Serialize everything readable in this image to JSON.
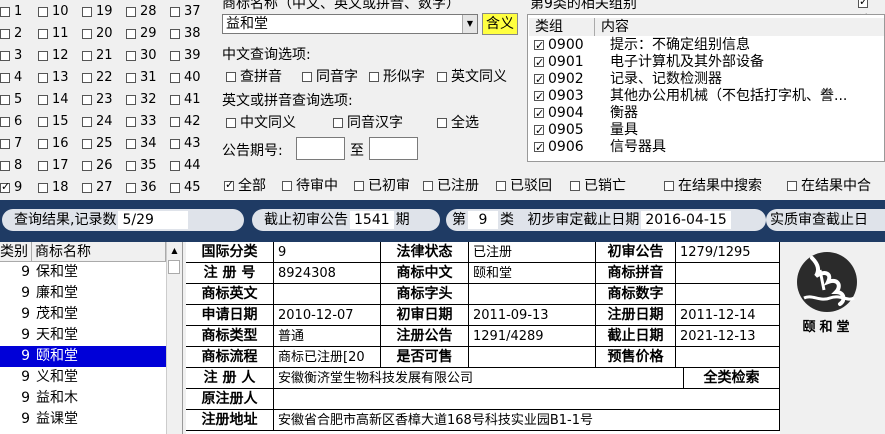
{
  "class_grid": {
    "columns": [
      [
        {
          "n": "1",
          "on": false
        },
        {
          "n": "2",
          "on": false
        },
        {
          "n": "3",
          "on": false
        },
        {
          "n": "4",
          "on": false
        },
        {
          "n": "5",
          "on": false
        },
        {
          "n": "6",
          "on": false
        },
        {
          "n": "7",
          "on": false
        },
        {
          "n": "8",
          "on": false
        },
        {
          "n": "9",
          "on": true
        }
      ],
      [
        {
          "n": "10",
          "on": false
        },
        {
          "n": "11",
          "on": false
        },
        {
          "n": "12",
          "on": false
        },
        {
          "n": "13",
          "on": false
        },
        {
          "n": "14",
          "on": false
        },
        {
          "n": "15",
          "on": false
        },
        {
          "n": "16",
          "on": false
        },
        {
          "n": "17",
          "on": false
        },
        {
          "n": "18",
          "on": false
        }
      ],
      [
        {
          "n": "19",
          "on": false
        },
        {
          "n": "20",
          "on": false
        },
        {
          "n": "21",
          "on": false
        },
        {
          "n": "22",
          "on": false
        },
        {
          "n": "23",
          "on": false
        },
        {
          "n": "24",
          "on": false
        },
        {
          "n": "25",
          "on": false
        },
        {
          "n": "26",
          "on": false
        },
        {
          "n": "27",
          "on": false
        }
      ],
      [
        {
          "n": "28",
          "on": false
        },
        {
          "n": "29",
          "on": false
        },
        {
          "n": "30",
          "on": false
        },
        {
          "n": "31",
          "on": false
        },
        {
          "n": "32",
          "on": false
        },
        {
          "n": "33",
          "on": false
        },
        {
          "n": "34",
          "on": false
        },
        {
          "n": "35",
          "on": false
        },
        {
          "n": "36",
          "on": false
        }
      ],
      [
        {
          "n": "37",
          "on": false
        },
        {
          "n": "38",
          "on": false
        },
        {
          "n": "39",
          "on": false
        },
        {
          "n": "40",
          "on": false
        },
        {
          "n": "41",
          "on": false
        },
        {
          "n": "42",
          "on": false
        },
        {
          "n": "43",
          "on": false
        },
        {
          "n": "44",
          "on": false
        },
        {
          "n": "45",
          "on": false
        }
      ]
    ]
  },
  "search": {
    "label": "商标名称（中文、英文或拼音、数字）",
    "value": "益和堂",
    "synonym_button": "含义",
    "chinese_options_label": "中文查询选项:",
    "chinese_options": [
      "查拼音",
      "同音字",
      "形似字",
      "英文同义"
    ],
    "english_options_label": "英文或拼音查询选项:",
    "english_options": [
      "中文同义",
      "同音汉字",
      "全选"
    ],
    "period_label": "公告期号:",
    "period_to": "至"
  },
  "groups": {
    "title": "第9类的相关组别",
    "headers": [
      "类组",
      "内容"
    ],
    "rows": [
      {
        "code": "0900",
        "text": "提示：不确定组别信息"
      },
      {
        "code": "0901",
        "text": "电子计算机及其外部设备"
      },
      {
        "code": "0902",
        "text": "记录、记数检测器"
      },
      {
        "code": "0903",
        "text": "其他办公用机械（不包括打字机、誊..."
      },
      {
        "code": "0904",
        "text": "衡器"
      },
      {
        "code": "0905",
        "text": "量具"
      },
      {
        "code": "0906",
        "text": "信号器具"
      }
    ]
  },
  "status_filters": [
    "全部",
    "待审中",
    "已初审",
    "已注册",
    "已驳回",
    "已销亡"
  ],
  "result_filters": [
    "在结果中搜索",
    "在结果中合"
  ],
  "bar": {
    "result_label": "查询结果,记录数",
    "result_value": "5/29",
    "cutoff_label": "截止初审公告",
    "cutoff_value": "1541",
    "cutoff_unit": "期",
    "class_prefix": "第",
    "class_value": "9",
    "class_suffix": "类",
    "prelim_label": "初步审定截止日期",
    "prelim_value": "2016-04-15",
    "substantive_label": "实质审查截止日"
  },
  "list": {
    "headers": [
      "类别",
      "商标名称"
    ],
    "rows": [
      {
        "n": "9",
        "name": "保和堂",
        "selected": false
      },
      {
        "n": "9",
        "name": "廉和堂",
        "selected": false
      },
      {
        "n": "9",
        "name": "茂和堂",
        "selected": false
      },
      {
        "n": "9",
        "name": "天和堂",
        "selected": false
      },
      {
        "n": "9",
        "name": "颐和堂",
        "selected": true
      },
      {
        "n": "9",
        "name": "义和堂",
        "selected": false
      },
      {
        "n": "9",
        "name": "益和木",
        "selected": false
      },
      {
        "n": "9",
        "name": "益课堂",
        "selected": false
      }
    ]
  },
  "detail": {
    "intl_class_k": "国际分类",
    "intl_class_v": "9",
    "legal_status_k": "法律状态",
    "legal_status_v": "已注册",
    "prelim_pub_k": "初审公告",
    "prelim_pub_v": "1279/1295",
    "reg_no_k": "注 册 号",
    "reg_no_v": "8924308",
    "cn_name_k": "商标中文",
    "cn_name_v": "颐和堂",
    "pinyin_k": "商标拼音",
    "pinyin_v": "",
    "en_name_k": "商标英文",
    "en_name_v": "",
    "letters_k": "商标字头",
    "letters_v": "",
    "digits_k": "商标数字",
    "digits_v": "",
    "apply_date_k": "申请日期",
    "apply_date_v": "2010-12-07",
    "prelim_date_k": "初审日期",
    "prelim_date_v": "2011-09-13",
    "reg_date_k": "注册日期",
    "reg_date_v": "2011-12-14",
    "type_k": "商标类型",
    "type_v": "普通",
    "reg_pub_k": "注册公告",
    "reg_pub_v": "1291/4289",
    "expiry_k": "截止日期",
    "expiry_v": "2021-12-13",
    "flow_k": "商标流程",
    "flow_v": "商标已注册[20",
    "shared_k": "是否可售",
    "shared_v": "",
    "presale_k": "预售价格",
    "presale_v": "",
    "registrant_k": "注 册 人",
    "registrant_v": "安徽衡济堂生物科技发展有限公司",
    "full_search": "全类检索",
    "orig_registrant_k": "原注册人",
    "orig_registrant_v": "",
    "address_k": "注册地址",
    "address_v": "安徽省合肥市高新区香樟大道168号科技实业园B1-1号"
  },
  "logo": {
    "caption": "颐和堂"
  },
  "colors": {
    "bar": "#1f3b64",
    "selected": "#0000d8",
    "highlight": "#ffff40"
  }
}
